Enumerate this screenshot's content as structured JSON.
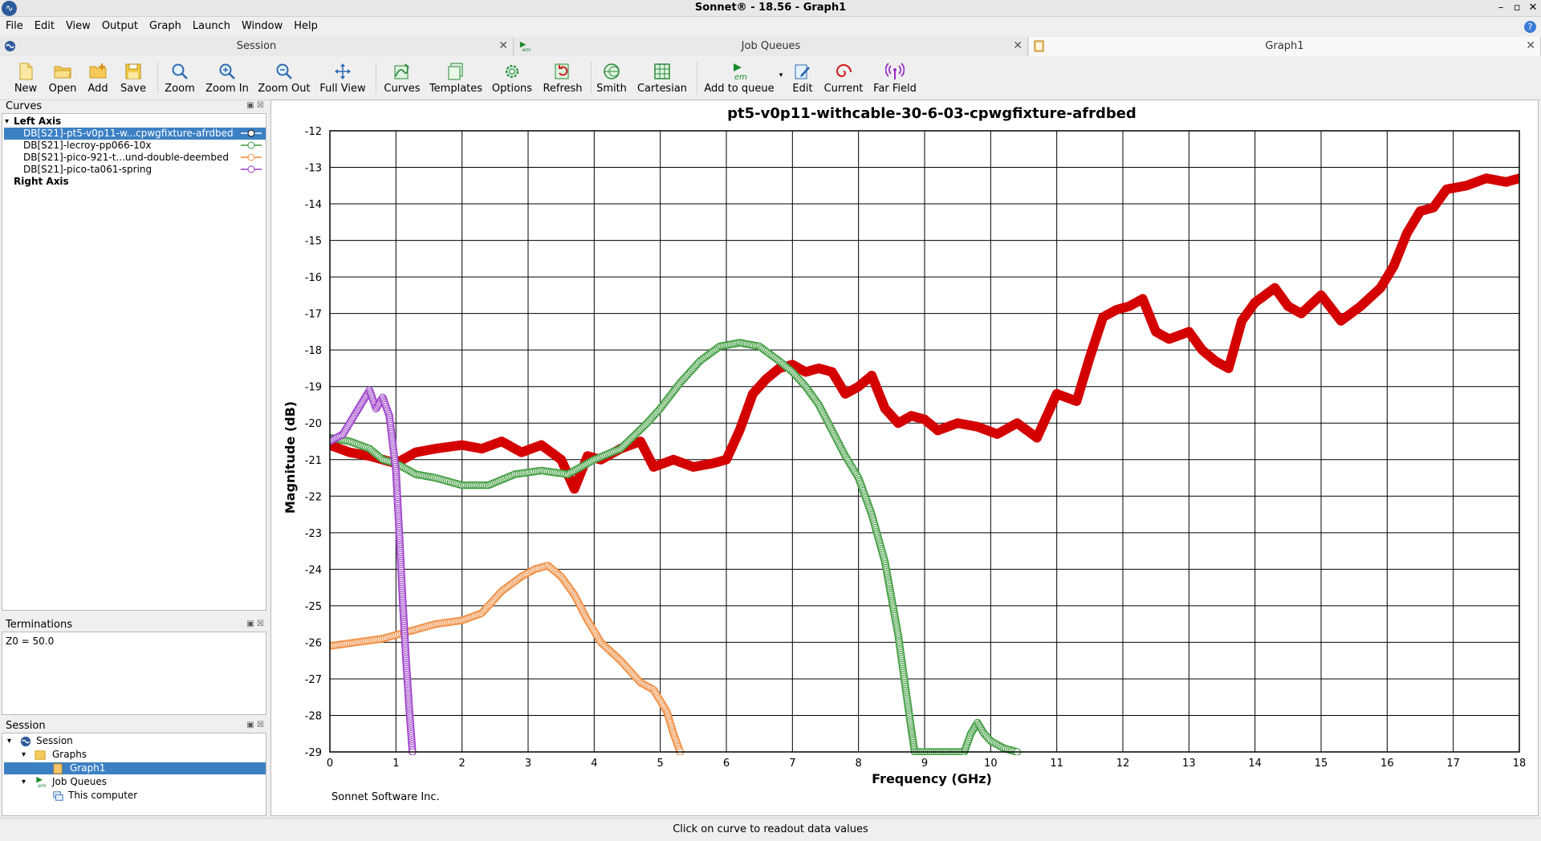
{
  "window": {
    "title": "Sonnet® - 18.56 - Graph1",
    "controls": {
      "minimize": "–",
      "maximize": "▫",
      "close": "✕"
    }
  },
  "menu": [
    "File",
    "Edit",
    "View",
    "Output",
    "Graph",
    "Launch",
    "Window",
    "Help"
  ],
  "tabs": [
    {
      "label": "Session",
      "active": false
    },
    {
      "label": "Job Queues",
      "active": false
    },
    {
      "label": "Graph1",
      "active": true
    }
  ],
  "toolbar": [
    {
      "label": "New",
      "icon": "new-file-icon"
    },
    {
      "label": "Open",
      "icon": "folder-open-icon"
    },
    {
      "label": "Add",
      "icon": "folder-add-icon"
    },
    {
      "label": "Save",
      "icon": "save-icon"
    },
    {
      "label": "Zoom",
      "icon": "magnifier-icon"
    },
    {
      "label": "Zoom In",
      "icon": "zoom-in-icon"
    },
    {
      "label": "Zoom Out",
      "icon": "zoom-out-icon"
    },
    {
      "label": "Full View",
      "icon": "full-view-icon"
    },
    {
      "label": "Curves",
      "icon": "curves-icon"
    },
    {
      "label": "Templates",
      "icon": "templates-icon"
    },
    {
      "label": "Options",
      "icon": "options-gear-icon"
    },
    {
      "label": "Refresh",
      "icon": "refresh-icon"
    },
    {
      "label": "Smith",
      "icon": "smith-chart-icon"
    },
    {
      "label": "Cartesian",
      "icon": "cartesian-grid-icon"
    },
    {
      "label": "Add to queue",
      "icon": "run-em-icon"
    },
    {
      "label": "Edit",
      "icon": "edit-icon"
    },
    {
      "label": "Current",
      "icon": "current-spiral-icon"
    },
    {
      "label": "Far Field",
      "icon": "far-field-antenna-icon"
    }
  ],
  "panels": {
    "curves": {
      "title": "Curves",
      "left_axis": "Left Axis",
      "right_axis": "Right Axis",
      "items": [
        {
          "label": "DB[S21]-pt5-v0p11-w...cpwgfixture-afrdbed",
          "color": "#d40000",
          "selected": true
        },
        {
          "label": "DB[S21]-lecroy-pp066-10x",
          "color": "#3d9b3d",
          "selected": false
        },
        {
          "label": "DB[S21]-pico-921-t...und-double-deembed",
          "color": "#f08a3c",
          "selected": false
        },
        {
          "label": "DB[S21]-pico-ta061-spring",
          "color": "#9b3dc8",
          "selected": false
        }
      ]
    },
    "terminations": {
      "title": "Terminations",
      "text": "Z0 = 50.0"
    },
    "session": {
      "title": "Session",
      "tree": [
        {
          "label": "Session",
          "level": 0,
          "icon": "session-icon"
        },
        {
          "label": "Graphs",
          "level": 1,
          "icon": "folder-icon"
        },
        {
          "label": "Graph1",
          "level": 2,
          "icon": "graph-icon",
          "selected": true
        },
        {
          "label": "Job Queues",
          "level": 1,
          "icon": "em-icon"
        },
        {
          "label": "This computer",
          "level": 2,
          "icon": "computer-icon"
        }
      ]
    }
  },
  "status": "Click on curve to readout data values",
  "footer_credit": "Sonnet Software Inc.",
  "chart_data": {
    "type": "scatter",
    "title": "pt5-v0p11-withcable-30-6-03-cpwgfixture-afrdbed",
    "xlabel": "Frequency (GHz)",
    "ylabel": "Magnitude (dB)",
    "xlim": [
      0,
      18
    ],
    "ylim": [
      -29,
      -12
    ],
    "xticks": [
      0,
      1,
      2,
      3,
      4,
      5,
      6,
      7,
      8,
      9,
      10,
      11,
      12,
      13,
      14,
      15,
      16,
      17,
      18
    ],
    "yticks": [
      -12,
      -13,
      -14,
      -15,
      -16,
      -17,
      -18,
      -19,
      -20,
      -21,
      -22,
      -23,
      -24,
      -25,
      -26,
      -27,
      -28,
      -29
    ],
    "grid": true,
    "series": [
      {
        "name": "DB[S21]-pt5-v0p11-w...cpwgfixture-afrdbed",
        "color": "#d40000",
        "marker": "filled-circle",
        "x": [
          0,
          0.3,
          0.6,
          1.0,
          1.3,
          1.6,
          2.0,
          2.3,
          2.6,
          2.9,
          3.2,
          3.5,
          3.7,
          3.9,
          4.1,
          4.4,
          4.7,
          4.9,
          5.2,
          5.5,
          5.8,
          6.0,
          6.2,
          6.4,
          6.6,
          6.8,
          7.0,
          7.2,
          7.4,
          7.6,
          7.8,
          8.0,
          8.2,
          8.4,
          8.6,
          8.8,
          9.0,
          9.2,
          9.5,
          9.8,
          10.1,
          10.4,
          10.7,
          11.0,
          11.3,
          11.5,
          11.7,
          11.9,
          12.1,
          12.3,
          12.5,
          12.7,
          13.0,
          13.2,
          13.4,
          13.6,
          13.8,
          14.0,
          14.3,
          14.5,
          14.7,
          15.0,
          15.3,
          15.6,
          15.9,
          16.1,
          16.3,
          16.5,
          16.7,
          16.9,
          17.2,
          17.5,
          17.8,
          18.0
        ],
        "y": [
          -20.6,
          -20.8,
          -20.9,
          -21.1,
          -20.8,
          -20.7,
          -20.6,
          -20.7,
          -20.5,
          -20.8,
          -20.6,
          -21.0,
          -21.8,
          -20.9,
          -21.0,
          -20.7,
          -20.5,
          -21.2,
          -21.0,
          -21.2,
          -21.1,
          -21.0,
          -20.2,
          -19.2,
          -18.8,
          -18.5,
          -18.4,
          -18.6,
          -18.5,
          -18.6,
          -19.2,
          -19.0,
          -18.7,
          -19.6,
          -20.0,
          -19.8,
          -19.9,
          -20.2,
          -20.0,
          -20.1,
          -20.3,
          -20.0,
          -20.4,
          -19.2,
          -19.4,
          -18.2,
          -17.1,
          -16.9,
          -16.8,
          -16.6,
          -17.5,
          -17.7,
          -17.5,
          -18.0,
          -18.3,
          -18.5,
          -17.2,
          -16.7,
          -16.3,
          -16.8,
          -17.0,
          -16.5,
          -17.2,
          -16.8,
          -16.3,
          -15.7,
          -14.8,
          -14.2,
          -14.1,
          -13.6,
          -13.5,
          -13.3,
          -13.4,
          -13.3
        ]
      },
      {
        "name": "DB[S21]-lecroy-pp066-10x",
        "color": "#3d9b3d",
        "marker": "open-circle",
        "x": [
          0,
          0.3,
          0.6,
          0.8,
          1.0,
          1.3,
          1.6,
          2.0,
          2.4,
          2.8,
          3.2,
          3.6,
          4.0,
          4.4,
          4.8,
          5.0,
          5.3,
          5.6,
          5.9,
          6.2,
          6.5,
          6.8,
          7.0,
          7.2,
          7.4,
          7.6,
          7.8,
          8.0,
          8.2,
          8.4,
          8.6,
          8.7,
          8.8,
          8.85,
          9.6,
          9.7,
          9.8,
          9.9,
          10.0,
          10.2,
          10.4
        ],
        "y": [
          -20.4,
          -20.5,
          -20.7,
          -21.0,
          -21.1,
          -21.4,
          -21.5,
          -21.7,
          -21.7,
          -21.4,
          -21.3,
          -21.4,
          -21.0,
          -20.7,
          -20.0,
          -19.6,
          -18.9,
          -18.3,
          -17.9,
          -17.8,
          -17.9,
          -18.3,
          -18.6,
          -19.0,
          -19.5,
          -20.2,
          -20.9,
          -21.5,
          -22.5,
          -23.8,
          -25.8,
          -27.1,
          -28.4,
          -29.0,
          -29.0,
          -28.5,
          -28.2,
          -28.5,
          -28.7,
          -28.9,
          -29.0
        ]
      },
      {
        "name": "DB[S21]-pico-921-t...und-double-deembed",
        "color": "#f08a3c",
        "marker": "open-circle",
        "x": [
          0,
          0.4,
          0.8,
          1.2,
          1.6,
          2.0,
          2.3,
          2.6,
          2.9,
          3.1,
          3.3,
          3.5,
          3.7,
          3.9,
          4.1,
          4.4,
          4.7,
          4.9,
          5.1,
          5.2,
          5.3
        ],
        "y": [
          -26.1,
          -26.0,
          -25.9,
          -25.7,
          -25.5,
          -25.4,
          -25.2,
          -24.6,
          -24.2,
          -24.0,
          -23.9,
          -24.2,
          -24.7,
          -25.4,
          -26.0,
          -26.5,
          -27.1,
          -27.3,
          -27.9,
          -28.5,
          -29.0
        ]
      },
      {
        "name": "DB[S21]-pico-ta061-spring",
        "color": "#9b3dc8",
        "marker": "open-circle",
        "x": [
          0,
          0.2,
          0.4,
          0.5,
          0.6,
          0.7,
          0.8,
          0.9,
          1.0,
          1.05,
          1.1,
          1.15,
          1.2,
          1.25
        ],
        "y": [
          -20.5,
          -20.3,
          -19.7,
          -19.4,
          -19.1,
          -19.6,
          -19.3,
          -19.8,
          -21.3,
          -23.0,
          -24.8,
          -26.4,
          -27.8,
          -29.0
        ]
      }
    ]
  }
}
